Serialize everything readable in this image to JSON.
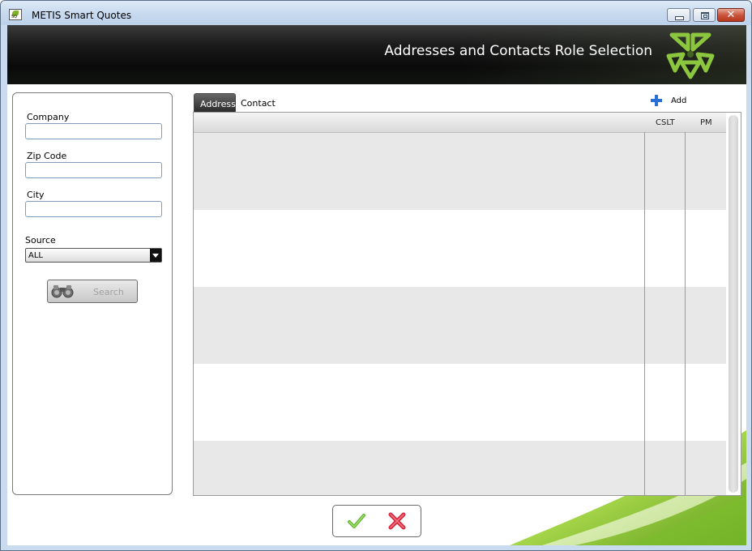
{
  "window": {
    "title": "METIS Smart Quotes",
    "icon_text": "SQ",
    "controls": [
      "minimize",
      "maximize",
      "close"
    ]
  },
  "header": {
    "title": "Addresses and Contacts Role Selection",
    "logo": "metis-logo-icon"
  },
  "filters": {
    "company_label": "Company",
    "company_value": "",
    "zip_label": "Zip Code",
    "zip_value": "",
    "city_label": "City",
    "city_value": "",
    "source_label": "Source",
    "source_value": "ALL",
    "search_label": "Search"
  },
  "tabs": [
    {
      "label": "Address",
      "active": true
    },
    {
      "label": "Contact",
      "active": false
    }
  ],
  "toolbar": {
    "add_label": "Add"
  },
  "grid": {
    "columns": [
      "",
      "CSLT",
      "PM"
    ],
    "rows": [
      [
        "",
        "",
        ""
      ],
      [
        "",
        "",
        ""
      ],
      [
        "",
        "",
        ""
      ],
      [
        "",
        "",
        ""
      ],
      [
        "",
        "",
        ""
      ]
    ]
  },
  "actions": {
    "ok_icon": "check-icon",
    "cancel_icon": "cross-icon"
  },
  "colors": {
    "accent_green": "#8cc63f",
    "header_dark": "#1a1a1a",
    "ok_green": "#5ab52a",
    "cancel_red": "#d8283c",
    "add_blue": "#2a6fd6"
  }
}
